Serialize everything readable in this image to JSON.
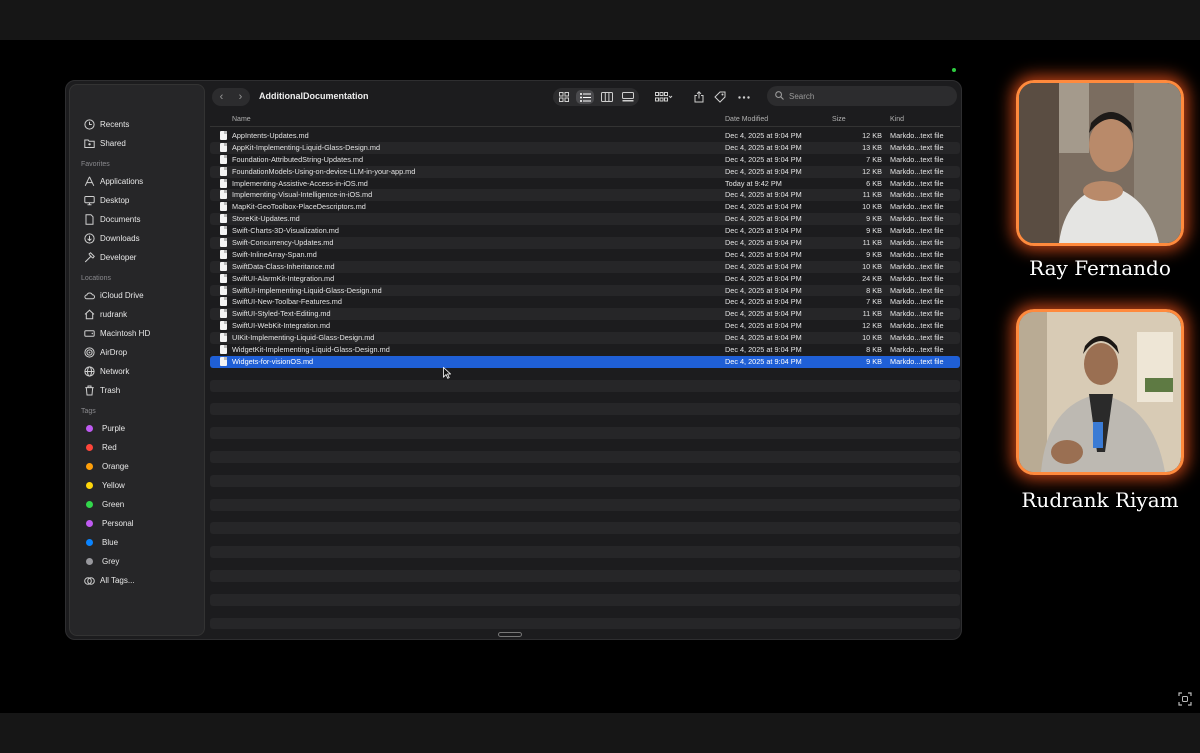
{
  "finder": {
    "title": "AdditionalDocumentation",
    "search_placeholder": "Search",
    "sidebar": {
      "top": [
        {
          "label": "Recents",
          "icon": "clock-icon"
        },
        {
          "label": "Shared",
          "icon": "shared-folder-icon"
        }
      ],
      "favorites_header": "Favorites",
      "favorites": [
        {
          "label": "Applications",
          "icon": "applications-icon"
        },
        {
          "label": "Desktop",
          "icon": "desktop-icon"
        },
        {
          "label": "Documents",
          "icon": "document-icon"
        },
        {
          "label": "Downloads",
          "icon": "download-icon"
        },
        {
          "label": "Developer",
          "icon": "hammer-icon"
        }
      ],
      "locations_header": "Locations",
      "locations": [
        {
          "label": "iCloud Drive",
          "icon": "cloud-icon"
        },
        {
          "label": "rudrank",
          "icon": "home-icon"
        },
        {
          "label": "Macintosh HD",
          "icon": "disk-icon"
        },
        {
          "label": "AirDrop",
          "icon": "airdrop-icon"
        },
        {
          "label": "Network",
          "icon": "globe-icon"
        },
        {
          "label": "Trash",
          "icon": "trash-icon"
        }
      ],
      "tags_header": "Tags",
      "tags": [
        {
          "label": "Purple",
          "color": "#bf5af2"
        },
        {
          "label": "Red",
          "color": "#ff453a"
        },
        {
          "label": "Orange",
          "color": "#ff9f0a"
        },
        {
          "label": "Yellow",
          "color": "#ffd60a"
        },
        {
          "label": "Green",
          "color": "#32d74b"
        },
        {
          "label": "Personal",
          "color": "#bf5af2"
        },
        {
          "label": "Blue",
          "color": "#0a84ff"
        },
        {
          "label": "Grey",
          "color": "#98989d"
        }
      ],
      "all_tags": "All Tags..."
    },
    "columns": {
      "name": "Name",
      "date": "Date Modified",
      "size": "Size",
      "kind": "Kind"
    },
    "files": [
      {
        "name": "AppIntents-Updates.md",
        "date": "Dec 4, 2025 at 9:04 PM",
        "size": "12 KB",
        "kind": "Markdo...text file"
      },
      {
        "name": "AppKit-Implementing-Liquid-Glass-Design.md",
        "date": "Dec 4, 2025 at 9:04 PM",
        "size": "13 KB",
        "kind": "Markdo...text file"
      },
      {
        "name": "Foundation-AttributedString-Updates.md",
        "date": "Dec 4, 2025 at 9:04 PM",
        "size": "7 KB",
        "kind": "Markdo...text file"
      },
      {
        "name": "FoundationModels-Using-on-device-LLM-in-your-app.md",
        "date": "Dec 4, 2025 at 9:04 PM",
        "size": "12 KB",
        "kind": "Markdo...text file"
      },
      {
        "name": "Implementing-Assistive-Access-in-iOS.md",
        "date": "Today at 9:42 PM",
        "size": "6 KB",
        "kind": "Markdo...text file"
      },
      {
        "name": "Implementing-Visual-Intelligence-in-iOS.md",
        "date": "Dec 4, 2025 at 9:04 PM",
        "size": "11 KB",
        "kind": "Markdo...text file"
      },
      {
        "name": "MapKit-GeoToolbox-PlaceDescriptors.md",
        "date": "Dec 4, 2025 at 9:04 PM",
        "size": "10 KB",
        "kind": "Markdo...text file"
      },
      {
        "name": "StoreKit-Updates.md",
        "date": "Dec 4, 2025 at 9:04 PM",
        "size": "9 KB",
        "kind": "Markdo...text file"
      },
      {
        "name": "Swift-Charts-3D-Visualization.md",
        "date": "Dec 4, 2025 at 9:04 PM",
        "size": "9 KB",
        "kind": "Markdo...text file"
      },
      {
        "name": "Swift-Concurrency-Updates.md",
        "date": "Dec 4, 2025 at 9:04 PM",
        "size": "11 KB",
        "kind": "Markdo...text file"
      },
      {
        "name": "Swift-InlineArray-Span.md",
        "date": "Dec 4, 2025 at 9:04 PM",
        "size": "9 KB",
        "kind": "Markdo...text file"
      },
      {
        "name": "SwiftData-Class-Inheritance.md",
        "date": "Dec 4, 2025 at 9:04 PM",
        "size": "10 KB",
        "kind": "Markdo...text file"
      },
      {
        "name": "SwiftUI-AlarmKit-Integration.md",
        "date": "Dec 4, 2025 at 9:04 PM",
        "size": "24 KB",
        "kind": "Markdo...text file"
      },
      {
        "name": "SwiftUI-Implementing-Liquid-Glass-Design.md",
        "date": "Dec 4, 2025 at 9:04 PM",
        "size": "8 KB",
        "kind": "Markdo...text file"
      },
      {
        "name": "SwiftUI-New-Toolbar-Features.md",
        "date": "Dec 4, 2025 at 9:04 PM",
        "size": "7 KB",
        "kind": "Markdo...text file"
      },
      {
        "name": "SwiftUI-Styled-Text-Editing.md",
        "date": "Dec 4, 2025 at 9:04 PM",
        "size": "11 KB",
        "kind": "Markdo...text file"
      },
      {
        "name": "SwiftUI-WebKit-Integration.md",
        "date": "Dec 4, 2025 at 9:04 PM",
        "size": "12 KB",
        "kind": "Markdo...text file"
      },
      {
        "name": "UIKit-Implementing-Liquid-Glass-Design.md",
        "date": "Dec 4, 2025 at 9:04 PM",
        "size": "10 KB",
        "kind": "Markdo...text file"
      },
      {
        "name": "WidgetKit-Implementing-Liquid-Glass-Design.md",
        "date": "Dec 4, 2025 at 9:04 PM",
        "size": "8 KB",
        "kind": "Markdo...text file"
      },
      {
        "name": "Widgets-for-visionOS.md",
        "date": "Dec 4, 2025 at 9:04 PM",
        "size": "9 KB",
        "kind": "Markdo...text file",
        "selected": true
      }
    ]
  },
  "participants": [
    {
      "name": "Ray Fernando"
    },
    {
      "name": "Rudrank Riyam"
    }
  ],
  "colors": {
    "accent": "#1f5fd6",
    "cam_border": "#ff8a3d"
  }
}
